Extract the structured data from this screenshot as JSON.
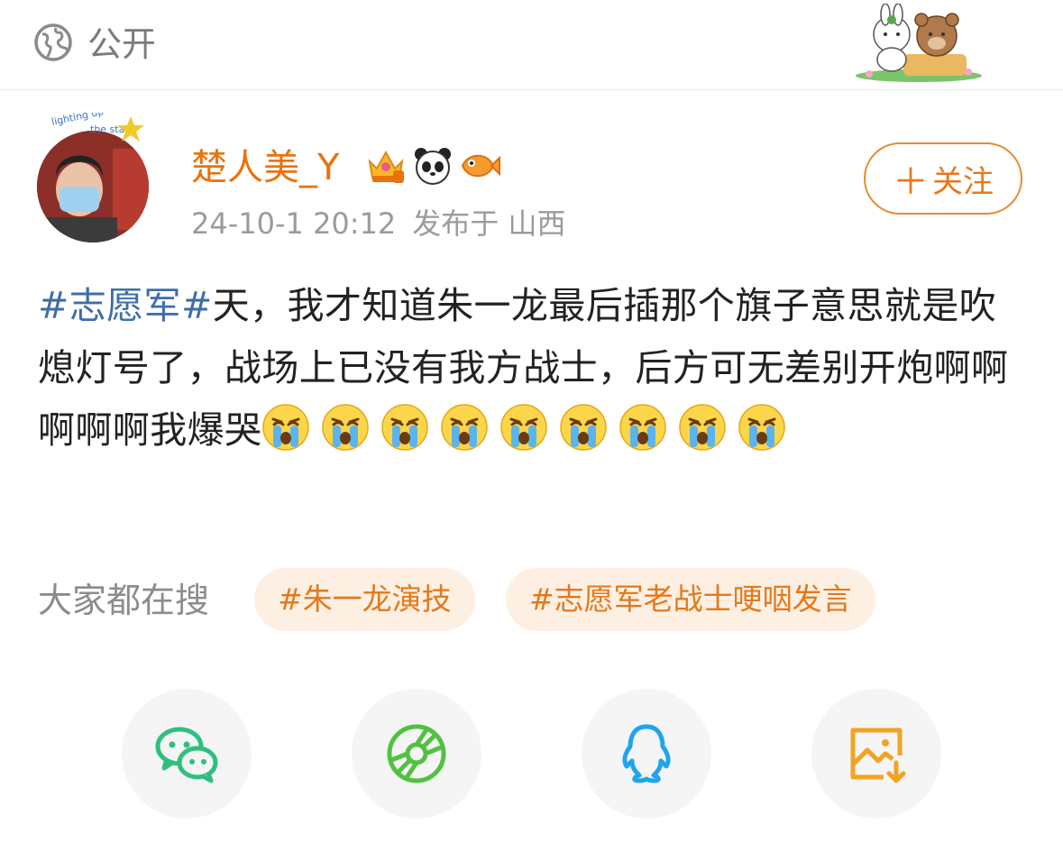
{
  "header": {
    "visibility_label": "公开",
    "visibility_icon": "globe-icon",
    "sticker": "bunny-and-bear-sticker"
  },
  "post": {
    "author": {
      "name": "楚人美_Y",
      "badges": [
        "crown-badge-icon",
        "panda-badge-icon",
        "fish-badge-icon"
      ]
    },
    "time": "24-10-1 20:12",
    "source": "发布于 山西",
    "follow_label": "关注",
    "text": {
      "hashtag": "#志愿军#",
      "body": "天，我才知道朱一龙最后插那个旗子意思就是吹熄灯号了，战场上已没有我方战士，后方可无差别开炮啊啊啊啊啊我爆哭",
      "emoji": "crying-face-emoji",
      "emoji_count": 9
    }
  },
  "search": {
    "label": "大家都在搜",
    "chips": [
      "#朱一龙演技",
      "#志愿军老战士哽咽发言"
    ]
  },
  "share": {
    "items": [
      {
        "name": "wechat-icon",
        "color": "#2fbf7e"
      },
      {
        "name": "moments-icon",
        "color": "#52c142"
      },
      {
        "name": "qq-icon",
        "color": "#1fa4ef"
      },
      {
        "name": "save-image-icon",
        "color": "#f2a323"
      }
    ]
  },
  "colors": {
    "accent": "#e8730a",
    "hashtag": "#3f6ea8",
    "chip_bg": "#fdf0e3"
  }
}
